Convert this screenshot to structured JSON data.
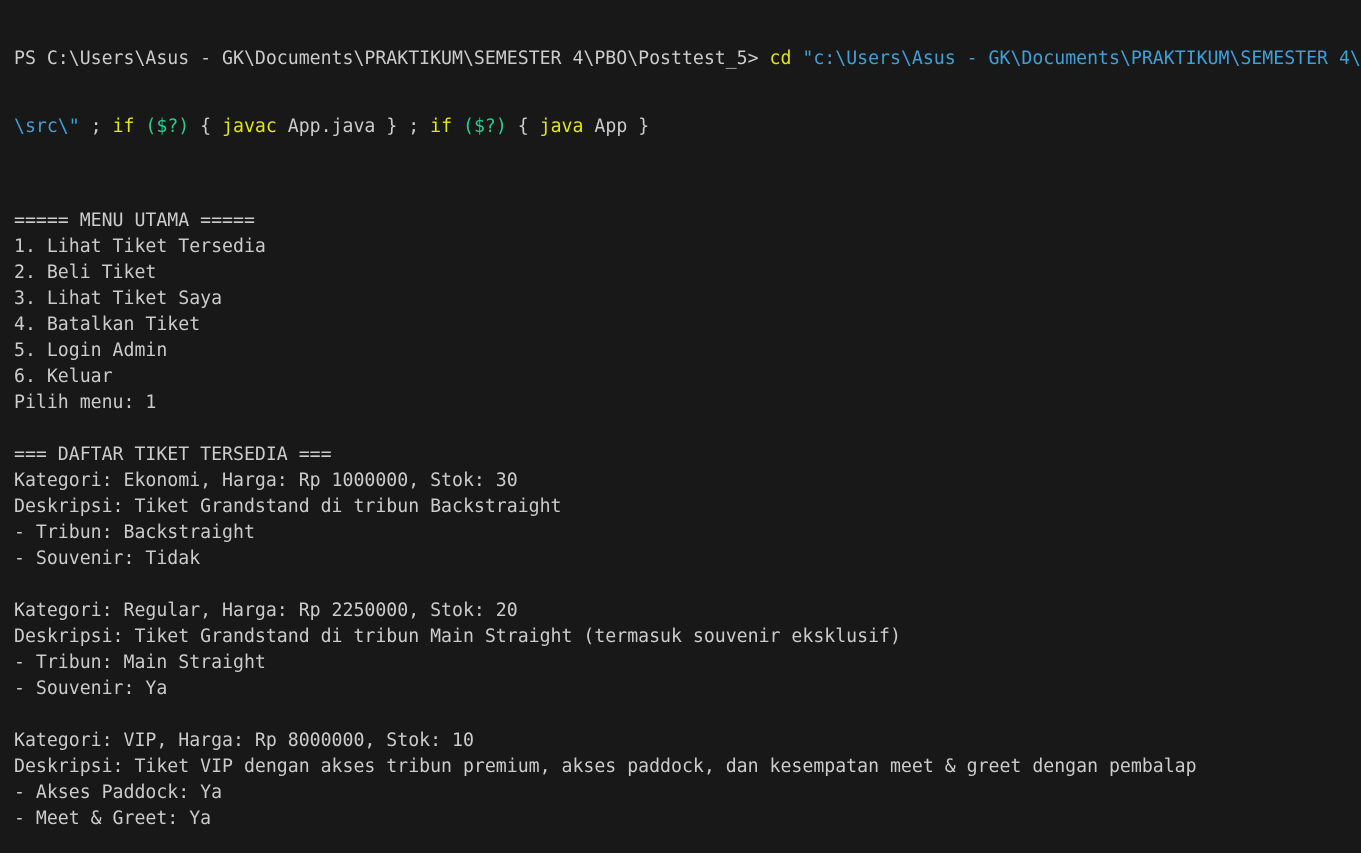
{
  "terminal": {
    "prompt": {
      "ps_prefix": "PS C:\\Users\\Asus - GK\\Documents\\PRAKTIKUM\\SEMESTER 4\\PBO\\Posttest_5> ",
      "cmd_cd": "cd",
      "cd_path": " \"c:\\Users\\Asus - GK\\Documents\\PRAKTIKUM\\SEMESTER 4\\",
      "cd_path_cont": "\\src\\\"",
      "sep1": " ; ",
      "if1": "if",
      "cond1": " ($?) ",
      "brace_open1": "{ ",
      "cmd_javac": "javac",
      "javac_arg": " App.java }",
      "sep2": " ; ",
      "if2": "if",
      "cond2": " ($?) ",
      "brace_open2": "{ ",
      "cmd_java": "java",
      "java_arg": " App }"
    },
    "output_lines": [
      "",
      "===== MENU UTAMA =====",
      "1. Lihat Tiket Tersedia",
      "2. Beli Tiket",
      "3. Lihat Tiket Saya",
      "4. Batalkan Tiket",
      "5. Login Admin",
      "6. Keluar",
      "Pilih menu: 1",
      "",
      "=== DAFTAR TIKET TERSEDIA ===",
      "Kategori: Ekonomi, Harga: Rp 1000000, Stok: 30",
      "Deskripsi: Tiket Grandstand di tribun Backstraight",
      "- Tribun: Backstraight",
      "- Souvenir: Tidak",
      "",
      "Kategori: Regular, Harga: Rp 2250000, Stok: 20",
      "Deskripsi: Tiket Grandstand di tribun Main Straight (termasuk souvenir eksklusif)",
      "- Tribun: Main Straight",
      "- Souvenir: Ya",
      "",
      "Kategori: VIP, Harga: Rp 8000000, Stok: 10",
      "Deskripsi: Tiket VIP dengan akses tribun premium, akses paddock, dan kesempatan meet & greet dengan pembalap",
      "- Akses Paddock: Ya",
      "- Meet & Greet: Ya"
    ]
  },
  "colors": {
    "background": "#181818",
    "text": "#cccccc",
    "command": "#e5e510",
    "string": "#3fa0d8",
    "keyword": "#23d18b"
  }
}
